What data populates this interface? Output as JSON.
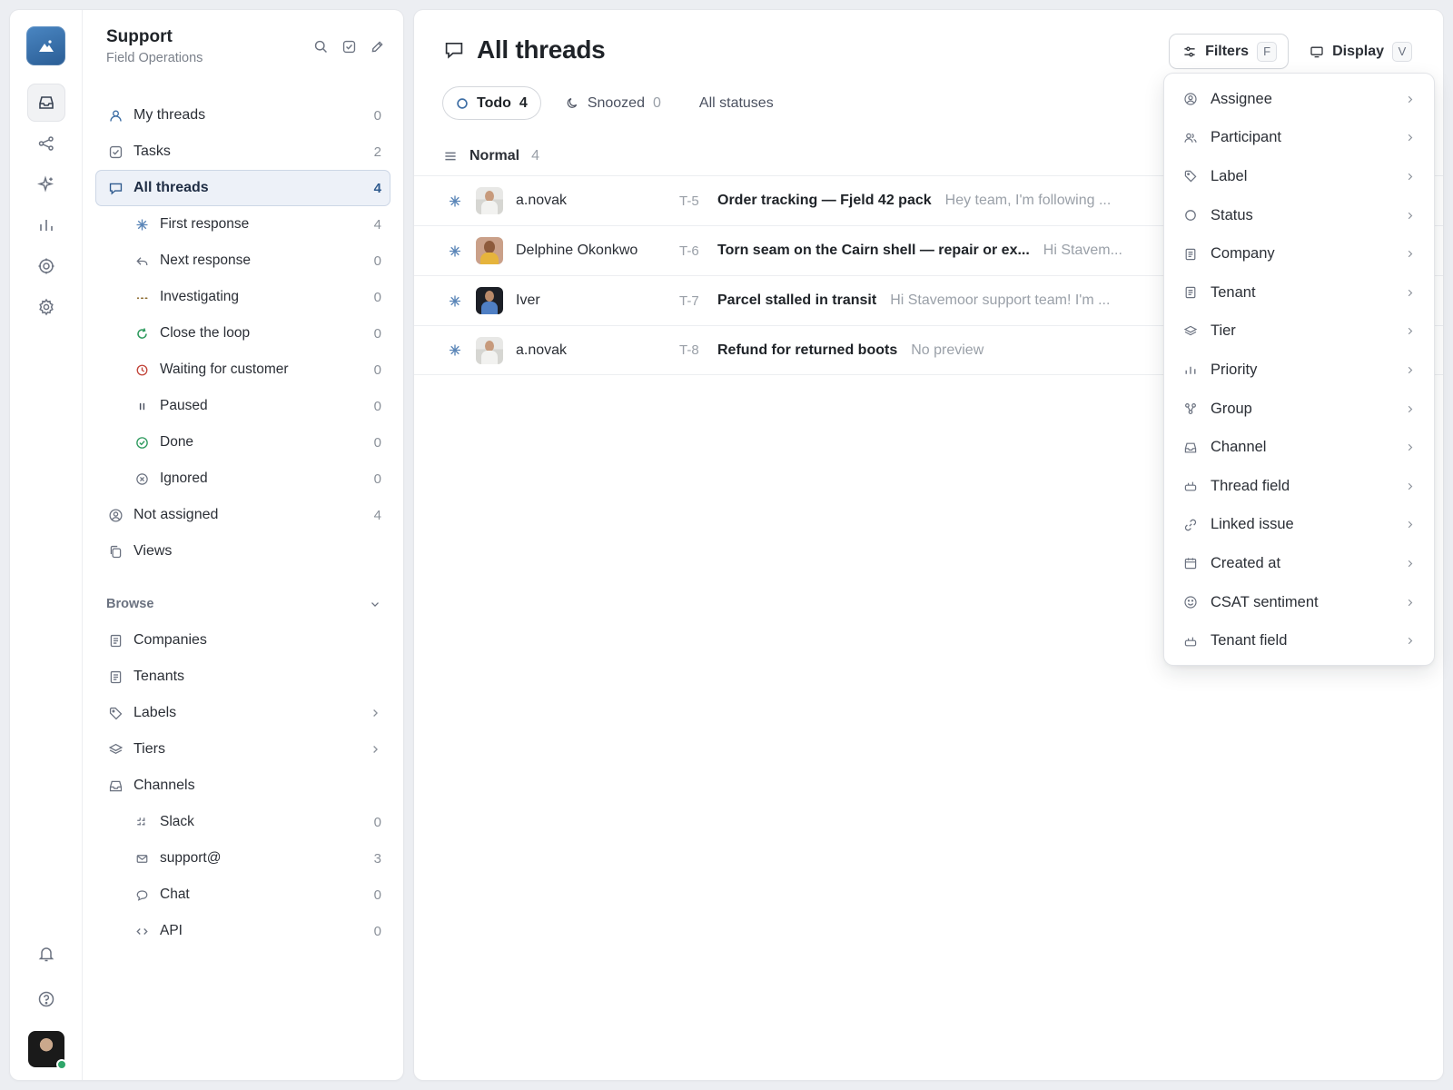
{
  "workspace": {
    "title": "Support",
    "subtitle": "Field Operations"
  },
  "sidebar": {
    "items": [
      {
        "label": "My threads",
        "count": "0"
      },
      {
        "label": "Tasks",
        "count": "2"
      },
      {
        "label": "All threads",
        "count": "4"
      }
    ],
    "statuses": [
      {
        "label": "First response",
        "count": "4"
      },
      {
        "label": "Next response",
        "count": "0"
      },
      {
        "label": "Investigating",
        "count": "0"
      },
      {
        "label": "Close the loop",
        "count": "0"
      },
      {
        "label": "Waiting for customer",
        "count": "0"
      },
      {
        "label": "Paused",
        "count": "0"
      },
      {
        "label": "Done",
        "count": "0"
      },
      {
        "label": "Ignored",
        "count": "0"
      }
    ],
    "extra": [
      {
        "label": "Not assigned",
        "count": "4"
      },
      {
        "label": "Views"
      }
    ],
    "browse": {
      "heading": "Browse",
      "items": [
        {
          "label": "Companies"
        },
        {
          "label": "Tenants"
        },
        {
          "label": "Labels"
        },
        {
          "label": "Tiers"
        },
        {
          "label": "Channels"
        }
      ],
      "channels": [
        {
          "label": "Slack",
          "count": "0"
        },
        {
          "label": "support@",
          "count": "3"
        },
        {
          "label": "Chat",
          "count": "0"
        },
        {
          "label": "API",
          "count": "0"
        }
      ]
    }
  },
  "main": {
    "title": "All threads",
    "filters_label": "Filters",
    "filters_key": "F",
    "display_label": "Display",
    "display_key": "V",
    "tabs": [
      {
        "label": "Todo",
        "count": "4"
      },
      {
        "label": "Snoozed",
        "count": "0"
      },
      {
        "label": "All statuses"
      }
    ],
    "group": {
      "label": "Normal",
      "count": "4"
    },
    "threads": [
      {
        "author": "a.novak",
        "id": "T-5",
        "subject": "Order tracking — Fjeld 42 pack",
        "preview": "Hey team, I'm following ..."
      },
      {
        "author": "Delphine Okonkwo",
        "id": "T-6",
        "subject": "Torn seam on the Cairn shell — repair or ex...",
        "preview": "Hi Stavem..."
      },
      {
        "author": "Iver",
        "id": "T-7",
        "subject": "Parcel stalled in transit",
        "preview": "Hi Stavemoor support team! I'm ..."
      },
      {
        "author": "a.novak",
        "id": "T-8",
        "subject": "Refund for returned boots",
        "preview": "No preview"
      }
    ]
  },
  "filter_menu": [
    {
      "label": "Assignee",
      "icon": "user-circle-icon"
    },
    {
      "label": "Participant",
      "icon": "users-icon"
    },
    {
      "label": "Label",
      "icon": "tag-icon"
    },
    {
      "label": "Status",
      "icon": "circle-icon"
    },
    {
      "label": "Company",
      "icon": "building-icon"
    },
    {
      "label": "Tenant",
      "icon": "building-icon"
    },
    {
      "label": "Tier",
      "icon": "layers-icon"
    },
    {
      "label": "Priority",
      "icon": "bars-icon"
    },
    {
      "label": "Group",
      "icon": "group-icon"
    },
    {
      "label": "Channel",
      "icon": "inbox-icon"
    },
    {
      "label": "Thread field",
      "icon": "field-icon"
    },
    {
      "label": "Linked issue",
      "icon": "link-icon"
    },
    {
      "label": "Created at",
      "icon": "calendar-icon"
    },
    {
      "label": "CSAT sentiment",
      "icon": "smile-icon"
    },
    {
      "label": "Tenant field",
      "icon": "field-icon"
    }
  ],
  "colors": {
    "accent": "#2f5a8e",
    "logo": "#3a74b0",
    "active_bg": "#edf1f8",
    "online": "#2fa66a"
  }
}
